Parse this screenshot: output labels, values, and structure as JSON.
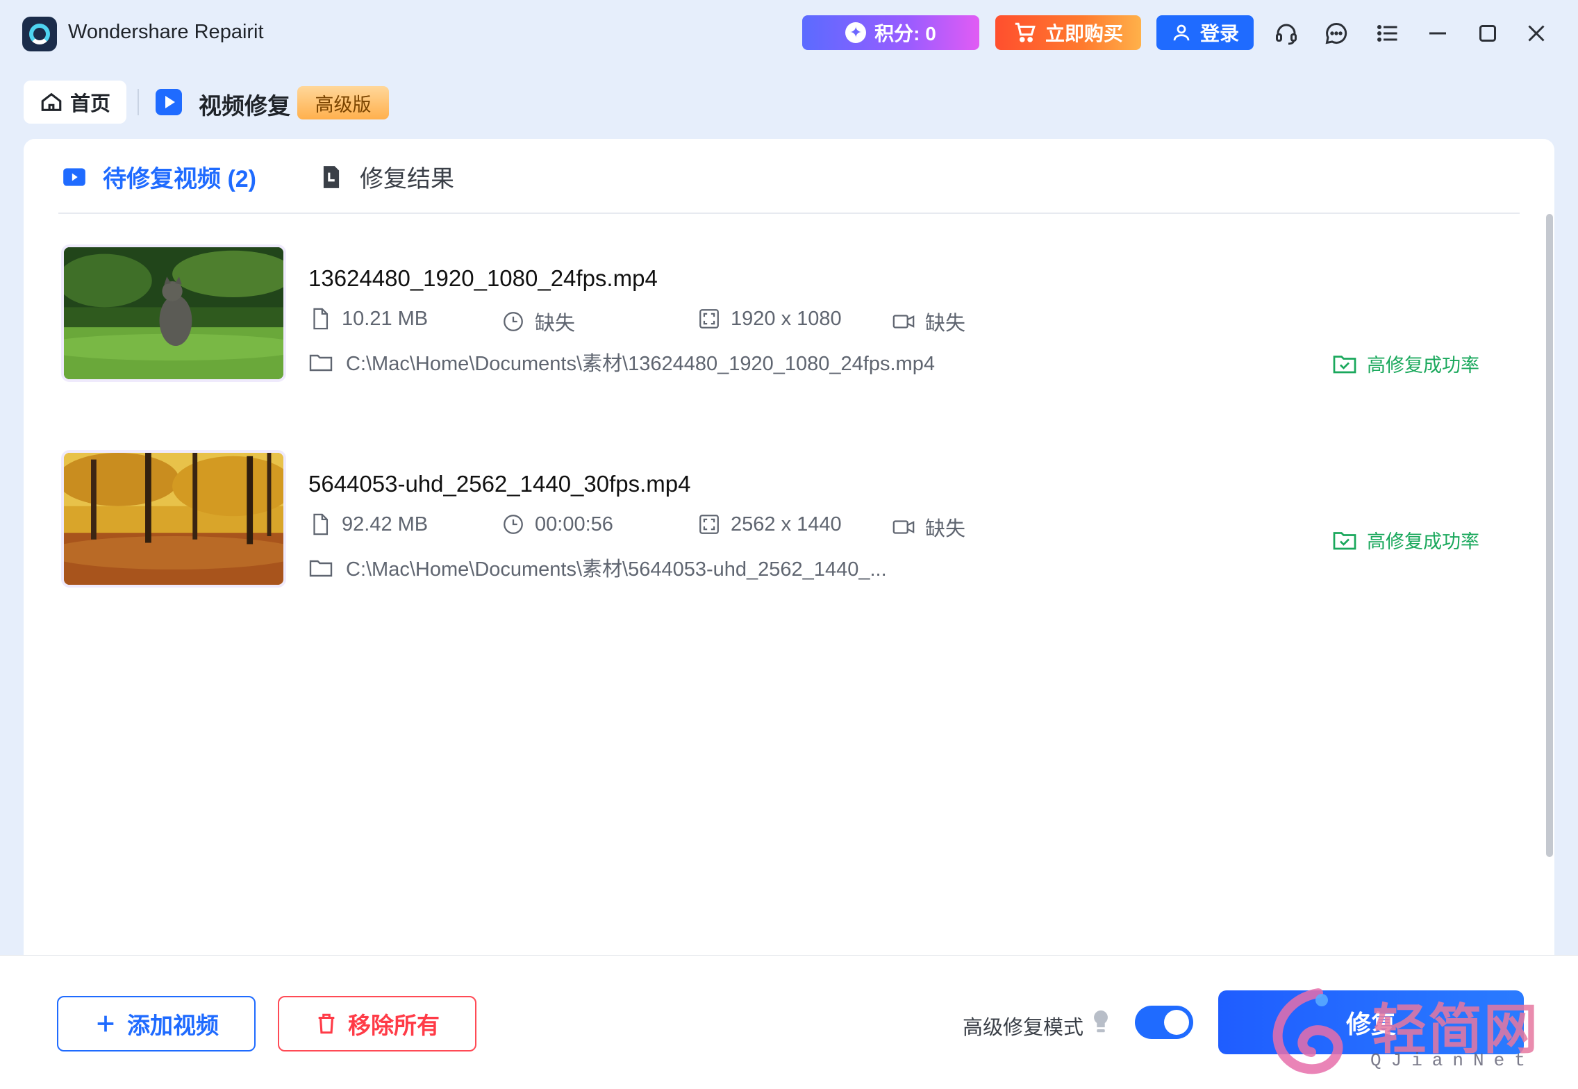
{
  "window": {
    "app_title": "Wondershare Repairit",
    "points_label": "积分: 0",
    "buy_label": "立即购买",
    "login_label": "登录"
  },
  "tabs": {
    "home_label": "首页",
    "module_label": "视频修复",
    "premium_badge": "高级版"
  },
  "panel": {
    "tab_pending": "待修复视频 (2)",
    "tab_results": "修复结果"
  },
  "videos": [
    {
      "name": "13624480_1920_1080_24fps.mp4",
      "size": "10.21 MB",
      "duration": "缺失",
      "resolution": "1920 x 1080",
      "codec": "缺失",
      "path": "C:\\Mac\\Home\\Documents\\素材\\13624480_1920_1080_24fps.mp4",
      "status": "高修复成功率"
    },
    {
      "name": "5644053-uhd_2562_1440_30fps.mp4",
      "size": "92.42 MB",
      "duration": "00:00:56",
      "resolution": "2562 x 1440",
      "codec": "缺失",
      "path": "C:\\Mac\\Home\\Documents\\素材\\5644053-uhd_2562_1440_...",
      "status": "高修复成功率"
    }
  ],
  "bottom": {
    "add_label": "添加视频",
    "remove_label": "移除所有",
    "mode_label": "高级修复模式",
    "mode_enabled": true,
    "repair_label": "修复"
  },
  "watermark": {
    "text": "轻简网",
    "sub": "QJianNet"
  },
  "colors": {
    "accent": "#1f6bff",
    "success": "#1aa85c",
    "danger": "#ff3b47",
    "premium": "#ffb04d"
  }
}
